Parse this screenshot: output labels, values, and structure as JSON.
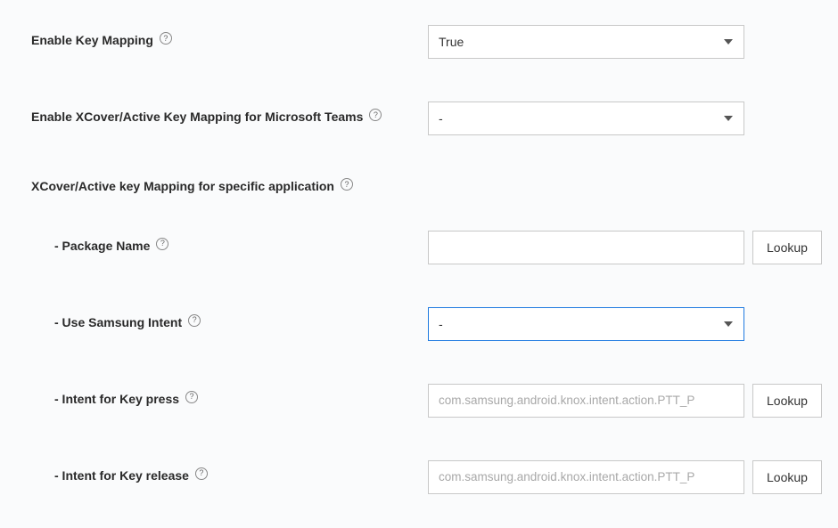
{
  "fields": {
    "enableKeyMapping": {
      "label": "Enable Key Mapping",
      "value": "True"
    },
    "enableXcoverTeams": {
      "label": "Enable XCover/Active Key Mapping for Microsoft Teams",
      "value": "-"
    },
    "xcoverSection": {
      "label": "XCover/Active key Mapping for specific application"
    },
    "packageName": {
      "label": "- Package Name",
      "value": "",
      "lookup": "Lookup"
    },
    "useSamsungIntent": {
      "label": "- Use Samsung Intent",
      "value": "-"
    },
    "intentKeyPress": {
      "label": "- Intent for Key press",
      "placeholder": "com.samsung.android.knox.intent.action.PTT_P",
      "lookup": "Lookup"
    },
    "intentKeyRelease": {
      "label": "- Intent for Key release",
      "placeholder": "com.samsung.android.knox.intent.action.PTT_P",
      "lookup": "Lookup"
    }
  }
}
